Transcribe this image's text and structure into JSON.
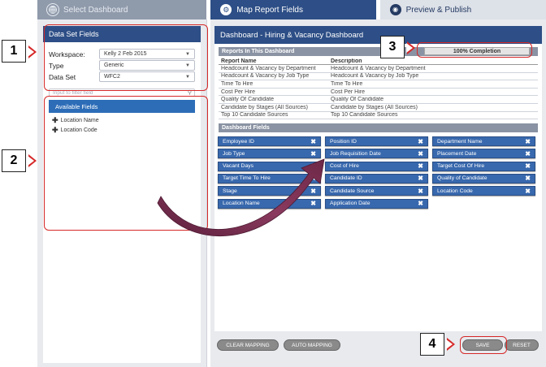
{
  "tabs": [
    {
      "label": "Select Dashboard",
      "icon": "dashboard-icon"
    },
    {
      "label": "Map Report Fields",
      "icon": "gear-icon"
    },
    {
      "label": "Preview & Publish",
      "icon": "eye-icon"
    }
  ],
  "left_panel": {
    "title": "Data Set Fields",
    "workspace": {
      "label": "Workspace:",
      "value": "Kelly 2 Feb 2015"
    },
    "type": {
      "label": "Type",
      "value": "Generic"
    },
    "dataset": {
      "label": "Data Set",
      "value": "WFC2"
    },
    "filter_placeholder": "Input to filter field",
    "available_header": "Available Fields",
    "fields": [
      "Location Name",
      "Location Code"
    ]
  },
  "right_panel": {
    "title": "Dashboard - Hiring & Vacancy Dashboard",
    "reports_header": "Reports In This Dashboard",
    "progress_text": "100% Completion",
    "progress_percent": 100,
    "table_headers": [
      "Report Name",
      "Description"
    ],
    "reports": [
      [
        "Headcount & Vacancy by Department",
        "Headcount & Vacancy by Department"
      ],
      [
        "Headcount & Vacancy by Job Type",
        "Headcount & Vacancy by Job Type"
      ],
      [
        "Time To Hire",
        "Time To Hire"
      ],
      [
        "Cost Per Hire",
        "Cost Per Hire"
      ],
      [
        "Quality Of Candidate",
        "Quality Of Candidate"
      ],
      [
        "Candidate by Stages (All Sources)",
        "Candidate by Stages (All Sources)"
      ],
      [
        "Top 10 Candidate Sources",
        "Top 10 Candidate Sources"
      ]
    ],
    "dashboard_fields_header": "Dashboard Fields",
    "dashboard_fields": [
      "Employee ID",
      "Position ID",
      "Department Name",
      "Job Type",
      "Job Requisition Date",
      "Placement Date",
      "Vacant Days",
      "Cost of Hire",
      "Target Cost Of Hire",
      "Target Time To Hire",
      "Candidate ID",
      "Quality of Candidate",
      "Stage",
      "Candidate Source",
      "Location Code",
      "Location Name",
      "Application Date"
    ],
    "remove_glyph": "✖"
  },
  "buttons": {
    "clear_mapping": "CLEAR MAPPING",
    "auto_mapping": "AUTO MAPPING",
    "save": "SAVE",
    "reset": "RESET"
  },
  "annotations": [
    "1",
    "2",
    "3",
    "4"
  ],
  "colors": {
    "header": "#2d4e86",
    "chip": "#3868ad",
    "annotation": "#d62828",
    "arrow": "#7a2a4e"
  }
}
